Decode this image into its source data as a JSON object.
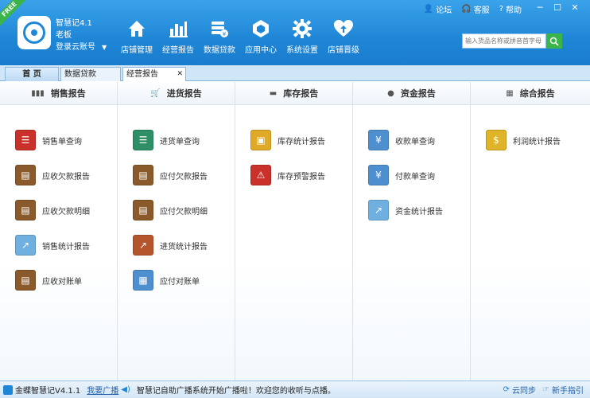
{
  "header": {
    "badge": "FREE",
    "app_name": "智慧记4.1",
    "role": "老板",
    "cloud_login": "登录云账号",
    "nav": [
      {
        "label": "店铺管理",
        "icon": "home-icon"
      },
      {
        "label": "经营报告",
        "icon": "bar-chart-icon"
      },
      {
        "label": "数据贷款",
        "icon": "loan-stack-icon"
      },
      {
        "label": "应用中心",
        "icon": "app-center-icon"
      },
      {
        "label": "系统设置",
        "icon": "gear-icon"
      },
      {
        "label": "店铺晋级",
        "icon": "heart-upgrade-icon"
      }
    ],
    "top_links": [
      {
        "label": "论坛",
        "icon": "user-icon"
      },
      {
        "label": "客服",
        "icon": "headset-icon"
      },
      {
        "label": "帮助",
        "icon": "help-icon"
      }
    ],
    "search_placeholder": "输入货品名称或拼音首字母"
  },
  "tabs": [
    {
      "label": "首 页"
    },
    {
      "label": "数据贷款"
    },
    {
      "label": "经营报告",
      "closable": true
    }
  ],
  "columns": [
    {
      "title": "销售报告",
      "icon": "bar-chart-icon",
      "items": [
        {
          "label": "销售单查询",
          "icon": "sales-order-icon",
          "color": "#c9312a"
        },
        {
          "label": "应收欠款报告",
          "icon": "wallet-icon",
          "color": "#3f7fc4"
        },
        {
          "label": "应收欠款明细",
          "icon": "wallet-detail-icon",
          "color": "#2e8f3e"
        },
        {
          "label": "销售统计报告",
          "icon": "stats-chart-icon",
          "color": "#3c9bd6"
        },
        {
          "label": "应收对账单",
          "icon": "reconcile-icon",
          "color": "#c46a2a"
        }
      ]
    },
    {
      "title": "进货报告",
      "icon": "cart-icon",
      "items": [
        {
          "label": "进货单查询",
          "icon": "purchase-order-icon",
          "color": "#2e8f66"
        },
        {
          "label": "应付欠款报告",
          "icon": "wallet-icon",
          "color": "#3f7fc4"
        },
        {
          "label": "应付欠款明细",
          "icon": "wallet-detail-icon",
          "color": "#2e8f3e"
        },
        {
          "label": "进货统计报告",
          "icon": "stats-chart-icon",
          "color": "#c4462a"
        },
        {
          "label": "应付对账单",
          "icon": "calendar-icon",
          "color": "#3c7fc4"
        }
      ]
    },
    {
      "title": "库存报告",
      "icon": "inventory-icon",
      "items": [
        {
          "label": "库存统计报告",
          "icon": "box-stats-icon",
          "color": "#e0a928"
        },
        {
          "label": "库存预警报告",
          "icon": "warning-icon",
          "color": "#c9312a"
        }
      ]
    },
    {
      "title": "资金报告",
      "icon": "coin-icon",
      "items": [
        {
          "label": "收款单查询",
          "icon": "yuan-receipt-icon",
          "color": "#3c7fc4"
        },
        {
          "label": "付款单查询",
          "icon": "yuan-payment-icon",
          "color": "#3c7fc4"
        },
        {
          "label": "资金统计报告",
          "icon": "fund-stats-icon",
          "color": "#3c9bd6"
        }
      ]
    },
    {
      "title": "综合报告",
      "icon": "grid-icon",
      "items": [
        {
          "label": "利润统计报告",
          "icon": "profit-icon",
          "color": "#e0b428"
        }
      ]
    }
  ],
  "status": {
    "version": "金蝶智慧记V4.1.1",
    "broadcast": "我要广播",
    "message": "智慧记自助广播系统开始广播啦！欢迎您的收听与点播。",
    "cloud_sync": "云同步",
    "guide": "新手指引"
  }
}
